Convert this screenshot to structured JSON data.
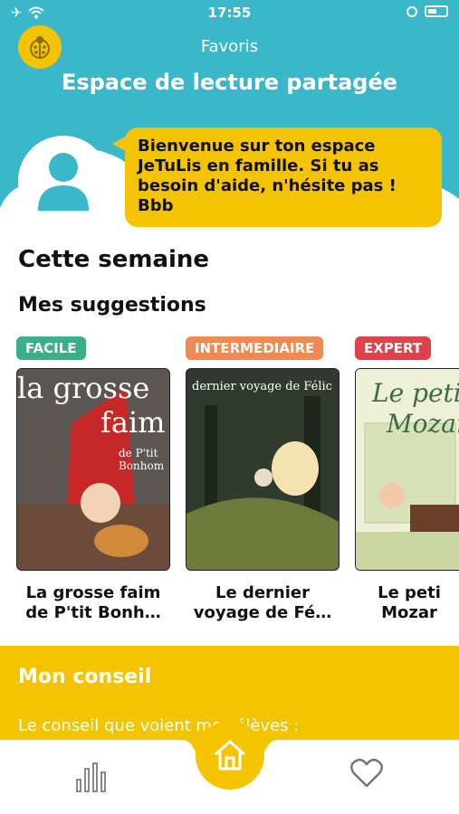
{
  "status_bar": {
    "time": "17:55"
  },
  "header": {
    "nav_title": "Favoris",
    "page_title": "Espace de lecture partagée",
    "welcome_message": "Bienvenue sur ton espace JeTuLis en famille. Si tu as besoin d'aide, n'hésite pas ! Bbb"
  },
  "main": {
    "section_title": "Cette semaine",
    "suggestions_title": "Mes suggestions",
    "books": [
      {
        "level": "FACILE",
        "level_color": "#3aaf8a",
        "title": "La grosse faim de P'tit Bonh…",
        "cover_text_1": "la grosse",
        "cover_text_2": "faim",
        "cover_text_3": "de P'tit Bonhom"
      },
      {
        "level": "INTERMEDIAIRE",
        "level_color": "#f08a52",
        "title": "Le dernier voyage de Fé…",
        "cover_text_1": "dernier voyage de Félic"
      },
      {
        "level": "EXPERT",
        "level_color": "#e0424d",
        "title": "Le peti Mozar",
        "cover_text_1": "Le peti",
        "cover_text_2": "Mozar"
      }
    ]
  },
  "advice": {
    "title": "Mon conseil",
    "text": "Le conseil que voient mes élèves :"
  },
  "tabbar": {
    "items": [
      "stats-icon",
      "home-icon",
      "heart-icon"
    ]
  },
  "colors": {
    "teal": "#3ab8c9",
    "yellow": "#f5c400"
  }
}
